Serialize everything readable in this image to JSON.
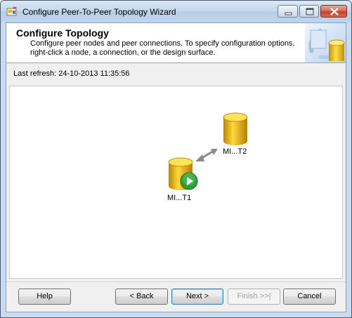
{
  "window": {
    "title": "Configure Peer-To-Peer Topology Wizard",
    "icon": "wizard-app-icon"
  },
  "header": {
    "title": "Configure Topology",
    "description": "Configure peer nodes and peer connections. To specify configuration options, right-click a node, a connection, or the design surface."
  },
  "status": {
    "last_refresh": "Last refresh: 24-10-2013 11:35:56"
  },
  "topology": {
    "nodes": [
      {
        "label": "MI...T1",
        "icon": "database-icon",
        "badge": "play-icon",
        "badge_color": "#2f9e3a"
      },
      {
        "label": "MI...T2",
        "icon": "database-icon"
      }
    ],
    "connection": {
      "icon": "bidirectional-arrow-icon"
    }
  },
  "buttons": {
    "help": "Help",
    "back": "< Back",
    "next": "Next >",
    "finish": "Finish >>|",
    "cancel": "Cancel"
  },
  "colors": {
    "database": "#e2b012",
    "title_bar": "#c5d8ee",
    "close_button": "#c2432a"
  }
}
